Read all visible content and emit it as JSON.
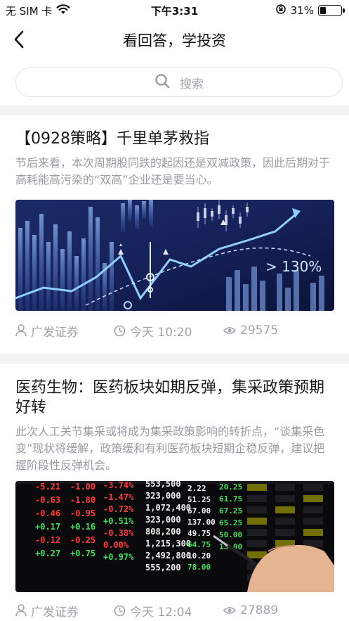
{
  "status_bar": {
    "carrier": "无 SIM 卡",
    "time": "下午3:31",
    "battery_percent_label": "31%",
    "battery_level": 0.31
  },
  "nav": {
    "title": "看回答，学投资"
  },
  "search": {
    "placeholder": "搜索"
  },
  "articles": [
    {
      "title": "【0928策略】千里单茅救指",
      "summary": "节后来看，本次周期股同跌的起因还是双减政策，因此后期对于高耗能高污染的“双高”企业还是要当心。",
      "image_label": "> 130%",
      "source": "广发证券",
      "time": "今天 10:20",
      "views": "29575"
    },
    {
      "title": "医药生物：医药板块如期反弹，集采政策预期好转",
      "summary": "此次人工关节集采或将成为集采政策影响的转折点，“谈集采色变”现状将缓解，政策缓和有利医药板块短期企稳反弹，建议把握阶段性反弹机会。",
      "source": "广发证券",
      "time": "今天 12:04",
      "views": "27889",
      "board": {
        "col1": [
          "-5.21",
          "-0.63",
          "-0.46",
          "+0.17",
          "-0.12",
          "+0.27"
        ],
        "col2": [
          "-1.00",
          "-1.80",
          "-0.95",
          "+0.16",
          "-0.25",
          "+0.75"
        ],
        "col3": [
          "-3.74%",
          "-1.47%",
          "-0.72%",
          "+0.51%",
          "-0.38%",
          "0.00%",
          "+0.97%"
        ],
        "col4": [
          "553,500",
          "323,000",
          "1,072,400",
          "323,000",
          "808,200",
          "1,215,300",
          "2,492,800",
          "555,200"
        ],
        "col5": [
          "2.22",
          "51.25",
          "67.00",
          "137.00",
          "49.75",
          "64.75",
          "10.20",
          "78.00"
        ],
        "col6": [
          "20.25",
          "61.75",
          "67.25",
          "65.25",
          "50.00",
          "13.00"
        ]
      }
    }
  ],
  "colors": {
    "accent_text": "#1a1a1a",
    "muted_text": "#9a9aa2",
    "board_green": "#3ee05a",
    "board_red": "#ff3b3b",
    "board_white": "#f2f2f2"
  }
}
